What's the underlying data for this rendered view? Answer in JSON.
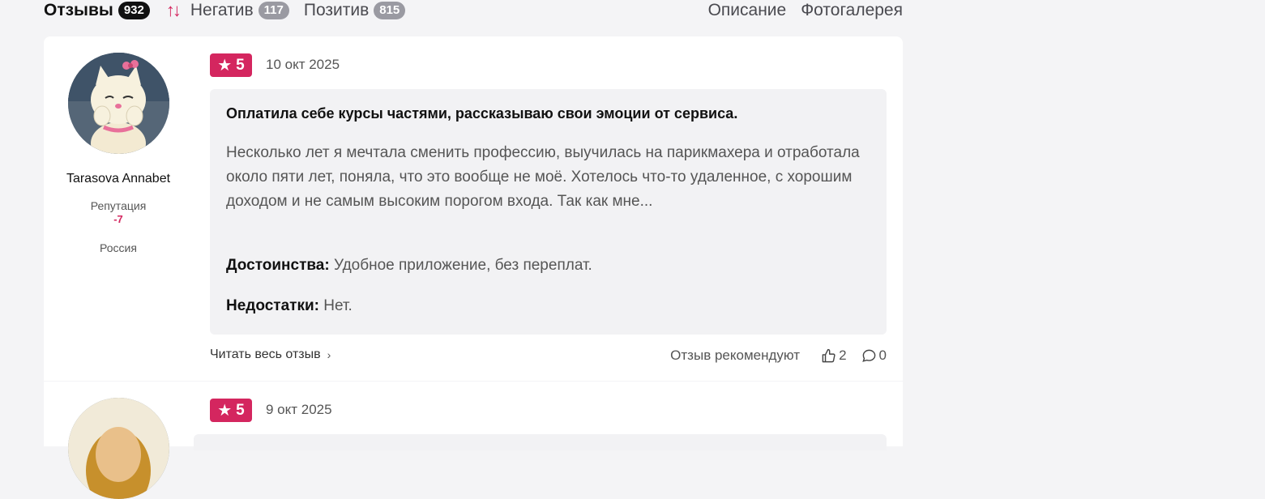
{
  "tabs": {
    "reviews_label": "Отзывы",
    "reviews_count": "932",
    "negative_label": "Негатив",
    "negative_count": "117",
    "positive_label": "Позитив",
    "positive_count": "815",
    "description_label": "Описание",
    "gallery_label": "Фотогалерея"
  },
  "colors": {
    "accent": "#d4265f",
    "card_bg": "#ffffff",
    "page_bg": "#f4f4f6"
  },
  "reviews": [
    {
      "author": "Tarasova Annabet",
      "reputation_label": "Репутация",
      "reputation_value": "-7",
      "country": "Россия",
      "rating": "5",
      "date": "10 окт 2025",
      "title": "Оплатила себе курсы частями, рассказываю свои эмоции от сервиса.",
      "text": "Несколько лет я мечтала сменить профессию, выучилась на парикмахера и отработала около пяти лет, поняла, что это вообще не моё. Хотелось что-то удаленное, с хорошим доходом и не самым высоким порогом входа. Так как мне...",
      "pros_label": "Достоинства:",
      "pros": "Удобное приложение, без переплат.",
      "cons_label": "Недостатки:",
      "cons": "Нет.",
      "read_more": "Читать весь отзыв",
      "recommend_label": "Отзыв рекомендуют",
      "likes": "2",
      "comments": "0"
    },
    {
      "rating": "5",
      "date": "9 окт 2025"
    }
  ]
}
